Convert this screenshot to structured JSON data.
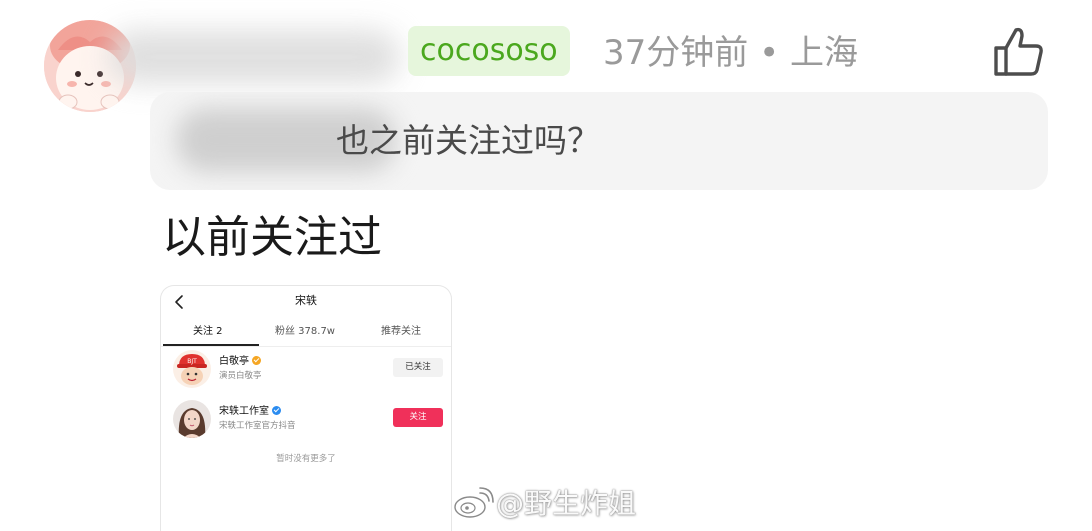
{
  "comment": {
    "tag": "cocososo",
    "time": "37分钟前",
    "separator": "•",
    "location": "上海",
    "quoted_reply_visible": "也之前关注过吗？",
    "reply_text": "以前关注过"
  },
  "screenshot": {
    "title": "宋轶",
    "tabs": [
      {
        "label": "关注 2",
        "active": true
      },
      {
        "label": "粉丝 378.7w",
        "active": false
      },
      {
        "label": "推荐关注",
        "active": false
      }
    ],
    "users": [
      {
        "name": "白敬亭",
        "desc": "演员白敬亭",
        "button": "已关注",
        "verify_color": "#f5a623",
        "avatar_badge": "BJT"
      },
      {
        "name": "宋轶工作室",
        "desc": "宋轶工作室官方抖音",
        "button": "关注",
        "verify_color": "#2b8cf0"
      }
    ],
    "footer": "暂时没有更多了"
  },
  "watermark": {
    "text": "@野生炸姐"
  },
  "colors": {
    "tag_bg": "#e6f6dc",
    "tag_text": "#4ba81e",
    "meta_text": "#9a9a9a",
    "follow_button": "#f0305a"
  },
  "icons": {
    "like": "thumbs-up-icon",
    "back": "chevron-left-icon",
    "watermark": "weibo-icon"
  }
}
